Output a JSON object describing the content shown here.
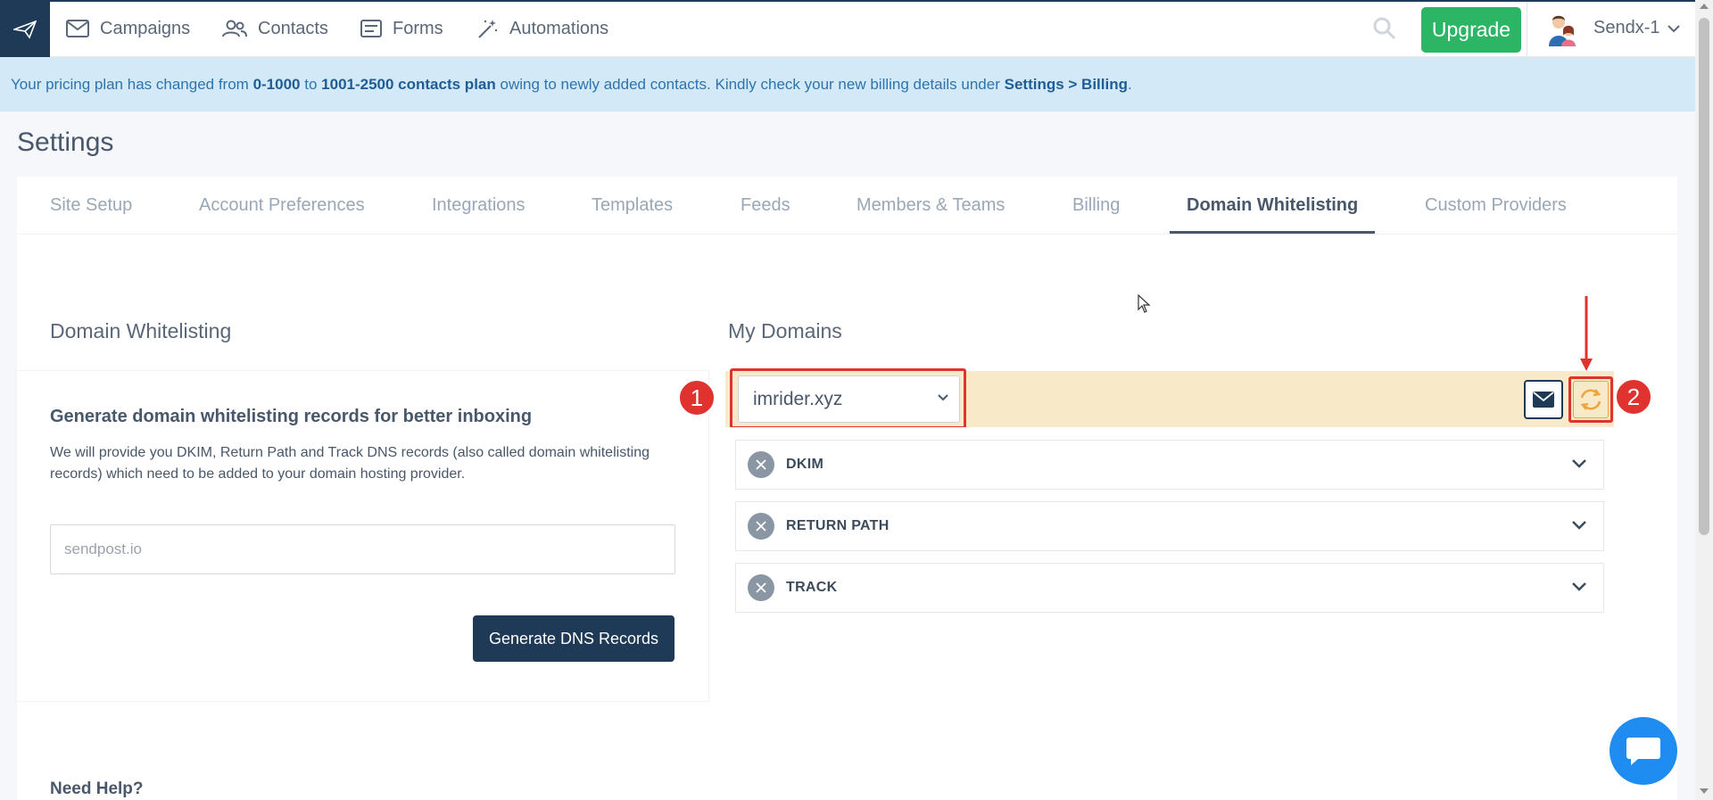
{
  "nav": {
    "items": [
      {
        "label": "Campaigns",
        "icon": "envelope-icon"
      },
      {
        "label": "Contacts",
        "icon": "users-icon"
      },
      {
        "label": "Forms",
        "icon": "form-icon"
      },
      {
        "label": "Automations",
        "icon": "magic-wand-icon"
      }
    ],
    "upgrade_label": "Upgrade",
    "account_name": "Sendx-1"
  },
  "banner": {
    "prefix": "Your pricing plan has changed from ",
    "from_plan": "0-1000",
    "mid1": " to ",
    "to_plan": "1001-2500 contacts plan",
    "mid2": " owing to newly added contacts. Kindly check your new billing details under ",
    "link": "Settings > Billing",
    "suffix": "."
  },
  "page_title": "Settings",
  "tabs": [
    {
      "label": "Site Setup"
    },
    {
      "label": "Account Preferences"
    },
    {
      "label": "Integrations"
    },
    {
      "label": "Templates"
    },
    {
      "label": "Feeds"
    },
    {
      "label": "Members & Teams"
    },
    {
      "label": "Billing"
    },
    {
      "label": "Domain Whitelisting",
      "active": true
    },
    {
      "label": "Custom Providers"
    }
  ],
  "left": {
    "section_title": "Domain Whitelisting",
    "heading": "Generate domain whitelisting records for better inboxing",
    "description": "We will provide you DKIM, Return Path and Track DNS records (also called domain whitelisting records) which need to be added to your domain hosting provider.",
    "input_placeholder": "sendpost.io",
    "button_label": "Generate DNS Records",
    "help_title": "Need Help?"
  },
  "right": {
    "section_title": "My Domains",
    "selected_domain": "imrider.xyz",
    "badge_1": "1",
    "badge_2": "2",
    "records": [
      {
        "label": "DKIM"
      },
      {
        "label": "RETURN PATH"
      },
      {
        "label": "TRACK"
      }
    ]
  },
  "colors": {
    "primary": "#1f3a56",
    "upgrade": "#2bb565",
    "banner_bg": "#d4e9f8",
    "domain_bar_bg": "#f8e9c8",
    "annotation_red": "#e0322f"
  }
}
